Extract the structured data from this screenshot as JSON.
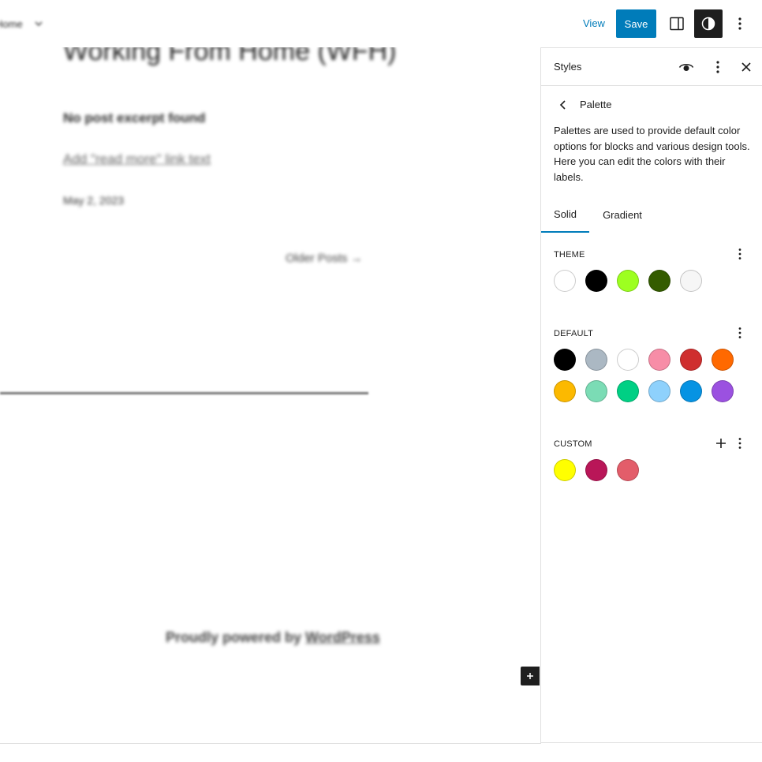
{
  "header": {
    "breadcrumb": "Home",
    "view_label": "View",
    "save_label": "Save"
  },
  "canvas": {
    "post_title": "Working From Home (WFH)",
    "excerpt": "No post excerpt found",
    "read_more": "Add \"read more\" link text",
    "date": "May 2, 2023",
    "older_posts": "Older Posts",
    "older_arrow": "→",
    "footer_prefix": "Proudly powered by ",
    "footer_link": "WordPress"
  },
  "sidebar": {
    "title": "Styles",
    "nav_title": "Palette",
    "description": "Palettes are used to provide default color options for blocks and various design tools. Here you can edit the colors with their labels.",
    "tabs": [
      "Solid",
      "Gradient"
    ],
    "active_tab": "Solid",
    "theme_label": "THEME",
    "default_label": "DEFAULT",
    "custom_label": "CUSTOM",
    "theme_colors": [
      "#ffffff",
      "#000000",
      "#9dff20",
      "#345c00",
      "#f6f6f6"
    ],
    "default_colors": [
      "#000000",
      "#abb8c3",
      "#ffffff",
      "#f78da7",
      "#cf2e2e",
      "#ff6900",
      "#fcb900",
      "#7bdcb5",
      "#00d084",
      "#8ed1fc",
      "#0693e3",
      "#9b51e0"
    ],
    "custom_colors": [
      "#ffff00",
      "#b91658",
      "#e35d6a"
    ]
  },
  "colors": {
    "accent": "#007cba",
    "dark": "#1e1e1e"
  }
}
